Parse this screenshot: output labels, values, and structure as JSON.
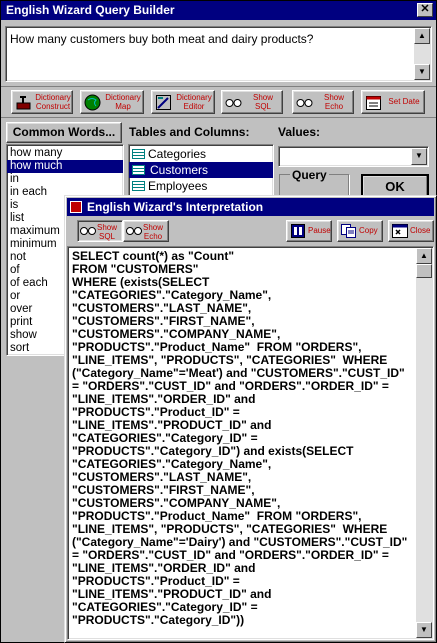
{
  "main_window": {
    "title": "English Wizard Query Builder",
    "question": "How many customers buy both meat and dairy products?"
  },
  "toolbar": [
    {
      "name": "dictionary-construct",
      "label1": "Dictionary",
      "label2": "Construct",
      "icon": "hammer-icon"
    },
    {
      "name": "dictionary-map",
      "label1": "Dictionary",
      "label2": "Map",
      "icon": "globe-icon"
    },
    {
      "name": "dictionary-editor",
      "label1": "Dictionary",
      "label2": "Editor",
      "icon": "editor-icon"
    },
    {
      "name": "show-sql",
      "label1": "Show",
      "label2": "SQL",
      "icon": "glasses-icon"
    },
    {
      "name": "show-echo",
      "label1": "Show",
      "label2": "Echo",
      "icon": "glasses-icon"
    },
    {
      "name": "set-date",
      "label1": "Set Date",
      "label2": "",
      "icon": "calendar-icon"
    }
  ],
  "common_words": {
    "button_label": "Common Words...",
    "items": [
      "how many",
      "how much",
      "in",
      "in each",
      "is",
      "list",
      "maximum",
      "minimum",
      "not",
      "of",
      "of each",
      "or",
      "over",
      "print",
      "show",
      "sort"
    ],
    "selected_index": 1
  },
  "tables_columns": {
    "label": "Tables and Columns:",
    "items": [
      "Categories",
      "Customers",
      "Employees"
    ],
    "selected_index": 1
  },
  "values": {
    "label": "Values:",
    "query_label": "Query",
    "ok_label": "OK"
  },
  "interpretation": {
    "title": "English Wizard's Interpretation",
    "show_sql_label1": "Show",
    "show_sql_label2": "SQL",
    "show_echo_label1": "Show",
    "show_echo_label2": "Echo",
    "pause_label": "Pause",
    "copy_label": "Copy",
    "close_label": "Close",
    "sql_lines": [
      "SELECT count(*) as \"Count\"",
      "FROM \"CUSTOMERS\"",
      "WHERE (exists(SELECT",
      "\"CATEGORIES\".\"Category_Name\",",
      "\"CUSTOMERS\".\"LAST_NAME\",",
      "\"CUSTOMERS\".\"FIRST_NAME\",",
      "\"CUSTOMERS\".\"COMPANY_NAME\",",
      "\"PRODUCTS\".\"Product_Name\"  FROM \"ORDERS\",",
      "\"LINE_ITEMS\", \"PRODUCTS\", \"CATEGORIES\"  WHERE",
      "(\"Category_Name\"='Meat') and \"CUSTOMERS\".\"CUST_ID\"",
      "= \"ORDERS\".\"CUST_ID\" and \"ORDERS\".\"ORDER_ID\" =",
      "\"LINE_ITEMS\".\"ORDER_ID\" and",
      "\"PRODUCTS\".\"Product_ID\" =",
      "\"LINE_ITEMS\".\"PRODUCT_ID\" and",
      "\"CATEGORIES\".\"Category_ID\" =",
      "\"PRODUCTS\".\"Category_ID\") and exists(SELECT",
      "\"CATEGORIES\".\"Category_Name\",",
      "\"CUSTOMERS\".\"LAST_NAME\",",
      "\"CUSTOMERS\".\"FIRST_NAME\",",
      "\"CUSTOMERS\".\"COMPANY_NAME\",",
      "\"PRODUCTS\".\"Product_Name\"  FROM \"ORDERS\",",
      "\"LINE_ITEMS\", \"PRODUCTS\", \"CATEGORIES\"  WHERE",
      "(\"Category_Name\"='Dairy') and \"CUSTOMERS\".\"CUST_ID\"",
      "= \"ORDERS\".\"CUST_ID\" and \"ORDERS\".\"ORDER_ID\" =",
      "\"LINE_ITEMS\".\"ORDER_ID\" and",
      "\"PRODUCTS\".\"Product_ID\" =",
      "\"LINE_ITEMS\".\"PRODUCT_ID\" and",
      "\"CATEGORIES\".\"Category_ID\" =",
      "\"PRODUCTS\".\"Category_ID\"))"
    ]
  }
}
